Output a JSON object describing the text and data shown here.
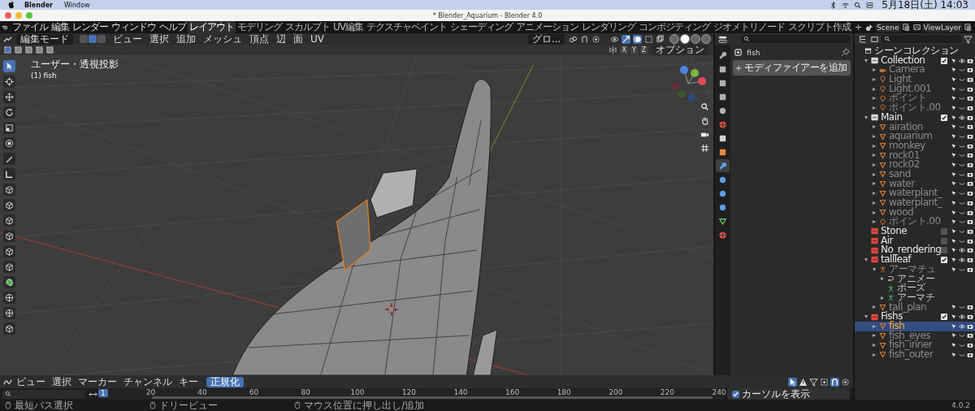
{
  "menubar": {
    "app": "Blender",
    "menus": [
      "Window"
    ],
    "clock": "5月18日(土) 14:03"
  },
  "window": {
    "title": "* Blender_Aquarium - Blender 4.0"
  },
  "topbar": {
    "menus": [
      "ファイル",
      "編集",
      "レンダー",
      "ウィンドウ",
      "ヘルプ"
    ],
    "workspaces": [
      {
        "label": "レイアウト",
        "selected": true
      },
      {
        "label": "モデリング",
        "selected": false
      },
      {
        "label": "スカルプト",
        "selected": false
      },
      {
        "label": "UV編集",
        "selected": false
      },
      {
        "label": "テクスチャペイント",
        "selected": false
      },
      {
        "label": "シェーディング",
        "selected": false
      },
      {
        "label": "アニメーション",
        "selected": false
      },
      {
        "label": "レンダリング",
        "selected": false
      },
      {
        "label": "コンポジティング",
        "selected": false
      },
      {
        "label": "ジオメトリノード",
        "selected": false
      },
      {
        "label": "スクリプト作成",
        "selected": false
      }
    ],
    "add_tab": "+",
    "scene": "Scene",
    "view_layer": "ViewLayer"
  },
  "viewport": {
    "mode": "編集モード",
    "select_modes": [
      {
        "selected": false
      },
      {
        "selected": true
      },
      {
        "selected": false
      }
    ],
    "menus": [
      "ビュー",
      "選択",
      "追加",
      "メッシュ",
      "頂点",
      "辺",
      "面",
      "UV"
    ],
    "orientation": "グロ...",
    "shading_modes": [
      {
        "selected": false
      },
      {
        "selected": true
      },
      {
        "selected": false
      },
      {
        "selected": false
      }
    ],
    "axes": [
      "X",
      "Y",
      "Z"
    ],
    "options": "オプション",
    "view_label": "ユーザー・透視投影",
    "object_label": "(1) fish",
    "tools": [
      {
        "kind": "select",
        "selected": true
      },
      {
        "kind": "cursor",
        "selected": false
      },
      {
        "kind": "move",
        "selected": false
      },
      {
        "kind": "rotate",
        "selected": false
      },
      {
        "kind": "scale",
        "selected": false
      },
      {
        "kind": "transform",
        "selected": false
      },
      {
        "kind": "pencil",
        "selected": false
      },
      {
        "kind": "ruler",
        "selected": false
      },
      {
        "kind": "cube",
        "selected": false
      },
      {
        "kind": "cube",
        "selected": false
      },
      {
        "kind": "cube",
        "selected": false
      },
      {
        "kind": "cube",
        "selected": false
      },
      {
        "kind": "cube",
        "selected": false
      },
      {
        "kind": "cube",
        "selected": false
      },
      {
        "kind": "blob",
        "selected": false
      },
      {
        "kind": "sphere",
        "selected": false
      },
      {
        "kind": "sphere",
        "selected": false
      },
      {
        "kind": "cube",
        "selected": false
      }
    ]
  },
  "properties": {
    "tabs": [
      {
        "kind": "wrench",
        "color": "#b0b0b0",
        "selected": false
      },
      {
        "kind": "square",
        "color": "#b0b0b0",
        "selected": false
      },
      {
        "kind": "square",
        "color": "#b0b0b0",
        "selected": false
      },
      {
        "kind": "square",
        "color": "#b0b0b0",
        "selected": false
      },
      {
        "kind": "circle",
        "color": "#b0b0b0",
        "selected": false
      },
      {
        "kind": "globe",
        "color": "#e0503c",
        "selected": false
      },
      {
        "kind": "square",
        "color": "#d0d0d0",
        "selected": false
      },
      {
        "kind": "square",
        "color": "#e8883a",
        "selected": false
      },
      {
        "kind": "wrench",
        "color": "#5a9fe8",
        "selected": true
      },
      {
        "kind": "circle",
        "color": "#5a9fe8",
        "selected": false
      },
      {
        "kind": "circle",
        "color": "#5a9fe8",
        "selected": false
      },
      {
        "kind": "circle",
        "color": "#5a9fe8",
        "selected": false
      },
      {
        "kind": "triangle",
        "color": "#5fc25f",
        "selected": false
      },
      {
        "kind": "globe",
        "color": "#e05050",
        "selected": false
      }
    ],
    "object": "fish",
    "add_modifier": "モディファイアーを追加"
  },
  "outliner": {
    "tree": {
      "label": "シーンコレクション",
      "kind": "scene",
      "children": [
        {
          "label": "Collection",
          "kind": "collection",
          "color": "#d8d8d8",
          "selected": false,
          "expanded": true,
          "checked": true,
          "visible": true,
          "children": [
            {
              "label": "Camera",
              "kind": "camera",
              "selected": false,
              "expanded": false,
              "visible": false
            },
            {
              "label": "Light",
              "kind": "light",
              "selected": false,
              "expanded": false,
              "visible": false
            },
            {
              "label": "Light.001",
              "kind": "light",
              "selected": false,
              "expanded": false,
              "visible": false
            },
            {
              "label": "ポイント",
              "kind": "light",
              "selected": false,
              "expanded": false,
              "visible": false
            },
            {
              "label": "ポイント.00",
              "kind": "light",
              "selected": false,
              "expanded": false,
              "visible": false
            }
          ]
        },
        {
          "label": "Main",
          "kind": "collection",
          "color": "#d8d8d8",
          "selected": false,
          "expanded": true,
          "checked": true,
          "visible": true,
          "children": [
            {
              "label": "airation",
              "kind": "mesh",
              "selected": false,
              "expanded": false,
              "visible": false
            },
            {
              "label": "aquarium",
              "kind": "mesh",
              "selected": false,
              "expanded": false,
              "visible": false
            },
            {
              "label": "monkey",
              "kind": "mesh",
              "selected": false,
              "expanded": false,
              "visible": false
            },
            {
              "label": "rock01",
              "kind": "mesh",
              "selected": false,
              "expanded": false,
              "visible": false
            },
            {
              "label": "rock02",
              "kind": "mesh",
              "selected": false,
              "expanded": false,
              "visible": false
            },
            {
              "label": "sand",
              "kind": "mesh",
              "selected": false,
              "expanded": false,
              "visible": false
            },
            {
              "label": "water",
              "kind": "mesh",
              "selected": false,
              "expanded": false,
              "visible": false
            },
            {
              "label": "waterplant_",
              "kind": "mesh",
              "selected": false,
              "expanded": false,
              "visible": false
            },
            {
              "label": "waterplant_",
              "kind": "mesh",
              "selected": false,
              "expanded": false,
              "visible": false
            },
            {
              "label": "wood",
              "kind": "mesh",
              "selected": false,
              "expanded": false,
              "visible": false
            },
            {
              "label": "ポイント.00",
              "kind": "light",
              "selected": false,
              "expanded": false,
              "visible": false
            }
          ]
        },
        {
          "label": "Stone",
          "kind": "collection",
          "color": "#e0463c",
          "selected": false,
          "checked": false,
          "visible": false
        },
        {
          "label": "Air",
          "kind": "collection",
          "color": "#e0463c",
          "selected": false,
          "checked": false,
          "visible": false
        },
        {
          "label": "No_rendering",
          "kind": "collection",
          "color": "#e0463c",
          "selected": false,
          "checked": false,
          "visible": true
        },
        {
          "label": "tallleaf",
          "kind": "collection",
          "color": "#e0463c",
          "selected": false,
          "expanded": true,
          "checked": true,
          "visible": true,
          "children": [
            {
              "label": "アーマチュ",
              "kind": "armature",
              "selected": false,
              "expanded": true,
              "visible": false,
              "children": [
                {
                  "label": "アニメー",
                  "kind": "action",
                  "selected": false,
                  "expanded": false
                },
                {
                  "label": "ポーズ",
                  "kind": "pose",
                  "selected": false
                },
                {
                  "label": "アーマチ",
                  "kind": "armature",
                  "selected": false,
                  "expanded": false
                }
              ]
            },
            {
              "label": "tall_plan",
              "kind": "mesh",
              "selected": false,
              "expanded": false,
              "visible": false
            }
          ]
        },
        {
          "label": "Fishs",
          "kind": "collection",
          "color": "#e0463c",
          "selected": false,
          "expanded": true,
          "checked": true,
          "visible": true,
          "children": [
            {
              "label": "fish",
              "kind": "mesh",
              "selected": true,
              "expanded": false,
              "visible": true
            },
            {
              "label": "fish_eyes",
              "kind": "mesh",
              "selected": false,
              "expanded": false,
              "visible": false
            },
            {
              "label": "fish_inner",
              "kind": "mesh",
              "selected": false,
              "expanded": false,
              "visible": false
            },
            {
              "label": "fish_outer",
              "kind": "mesh",
              "selected": false,
              "expanded": false,
              "visible": false
            }
          ]
        }
      ]
    }
  },
  "timeline": {
    "menus": [
      "ビュー",
      "選択",
      "マーカー",
      "チャンネル",
      "キー"
    ],
    "normalize": {
      "label": "正規化",
      "on": true
    },
    "current_frame": "1",
    "ticks": [
      "20",
      "40",
      "60",
      "80",
      "100",
      "120",
      "140",
      "160",
      "180",
      "200",
      "220",
      "240"
    ],
    "show_cursor": {
      "label": "カーソルを表示",
      "checked": true
    }
  },
  "status_bar": {
    "hints": [
      "最短パス選択",
      "ドリービュー",
      "マウス位置に押し出し/追加"
    ],
    "version": "4.0.2"
  }
}
